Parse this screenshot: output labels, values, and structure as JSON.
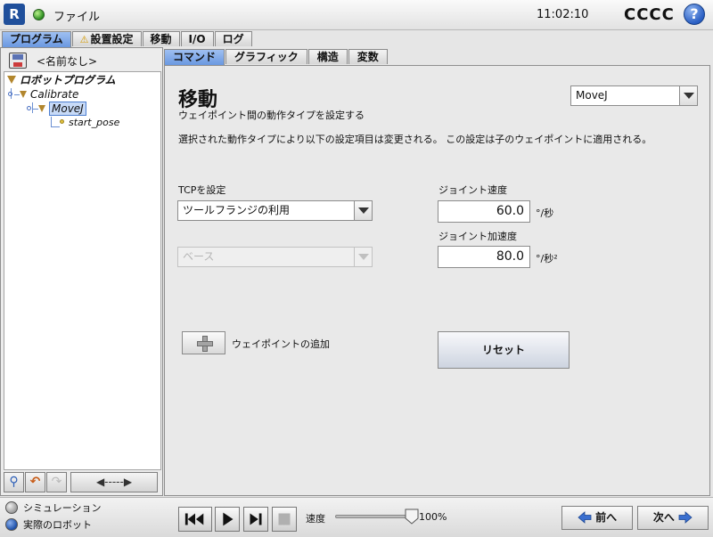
{
  "header": {
    "logo_text": "R",
    "file_menu": "ファイル",
    "time": "11:02:10",
    "robot_name": "CCCC",
    "help_symbol": "?"
  },
  "main_tabs": [
    {
      "label": "プログラム",
      "active": true
    },
    {
      "label": "設置設定",
      "active": false,
      "icon": "warning-icon"
    },
    {
      "label": "移動",
      "active": false
    },
    {
      "label": "I/O",
      "active": false
    },
    {
      "label": "ログ",
      "active": false
    }
  ],
  "left_panel": {
    "program_name": "<名前なし>",
    "tree": {
      "root": "ロボットプログラム",
      "calibrate": "Calibrate",
      "movej": "MoveJ",
      "start_pose": "start_pose"
    },
    "tools": {
      "nav_glyph": "◀-----▶"
    }
  },
  "sub_tabs": [
    {
      "label": "コマンド",
      "active": true
    },
    {
      "label": "グラフィック",
      "active": false
    },
    {
      "label": "構造",
      "active": false
    },
    {
      "label": "変数",
      "active": false
    }
  ],
  "content": {
    "title": "移動",
    "subtitle": "ウェイポイント間の動作タイプを設定する",
    "description": "選択された動作タイプにより以下の設定項目は変更される。 この設定は子のウェイポイントに適用される。",
    "move_type": "MoveJ",
    "tcp_label": "TCPを設定",
    "tcp_value": "ツールフランジの利用",
    "feature_value": "ベース",
    "joint_speed_label": "ジョイント速度",
    "joint_speed_value": "60.0",
    "joint_speed_unit": "°/秒",
    "joint_accel_label": "ジョイント加速度",
    "joint_accel_value": "80.0",
    "joint_accel_unit": "°/秒²",
    "add_waypoint_label": "ウェイポイントの追加",
    "reset_label": "リセット"
  },
  "bottom": {
    "simulation_label": "シミュレーション",
    "real_robot_label": "実際のロボット",
    "speed_label": "速度",
    "speed_value": "100%",
    "speed_fraction": 1.0,
    "prev_label": "前へ",
    "next_label": "次へ"
  },
  "colors": {
    "active_tab": "#7aa5e6",
    "brand_blue": "#1f4f9b",
    "status_green": "#2a8d1f"
  }
}
